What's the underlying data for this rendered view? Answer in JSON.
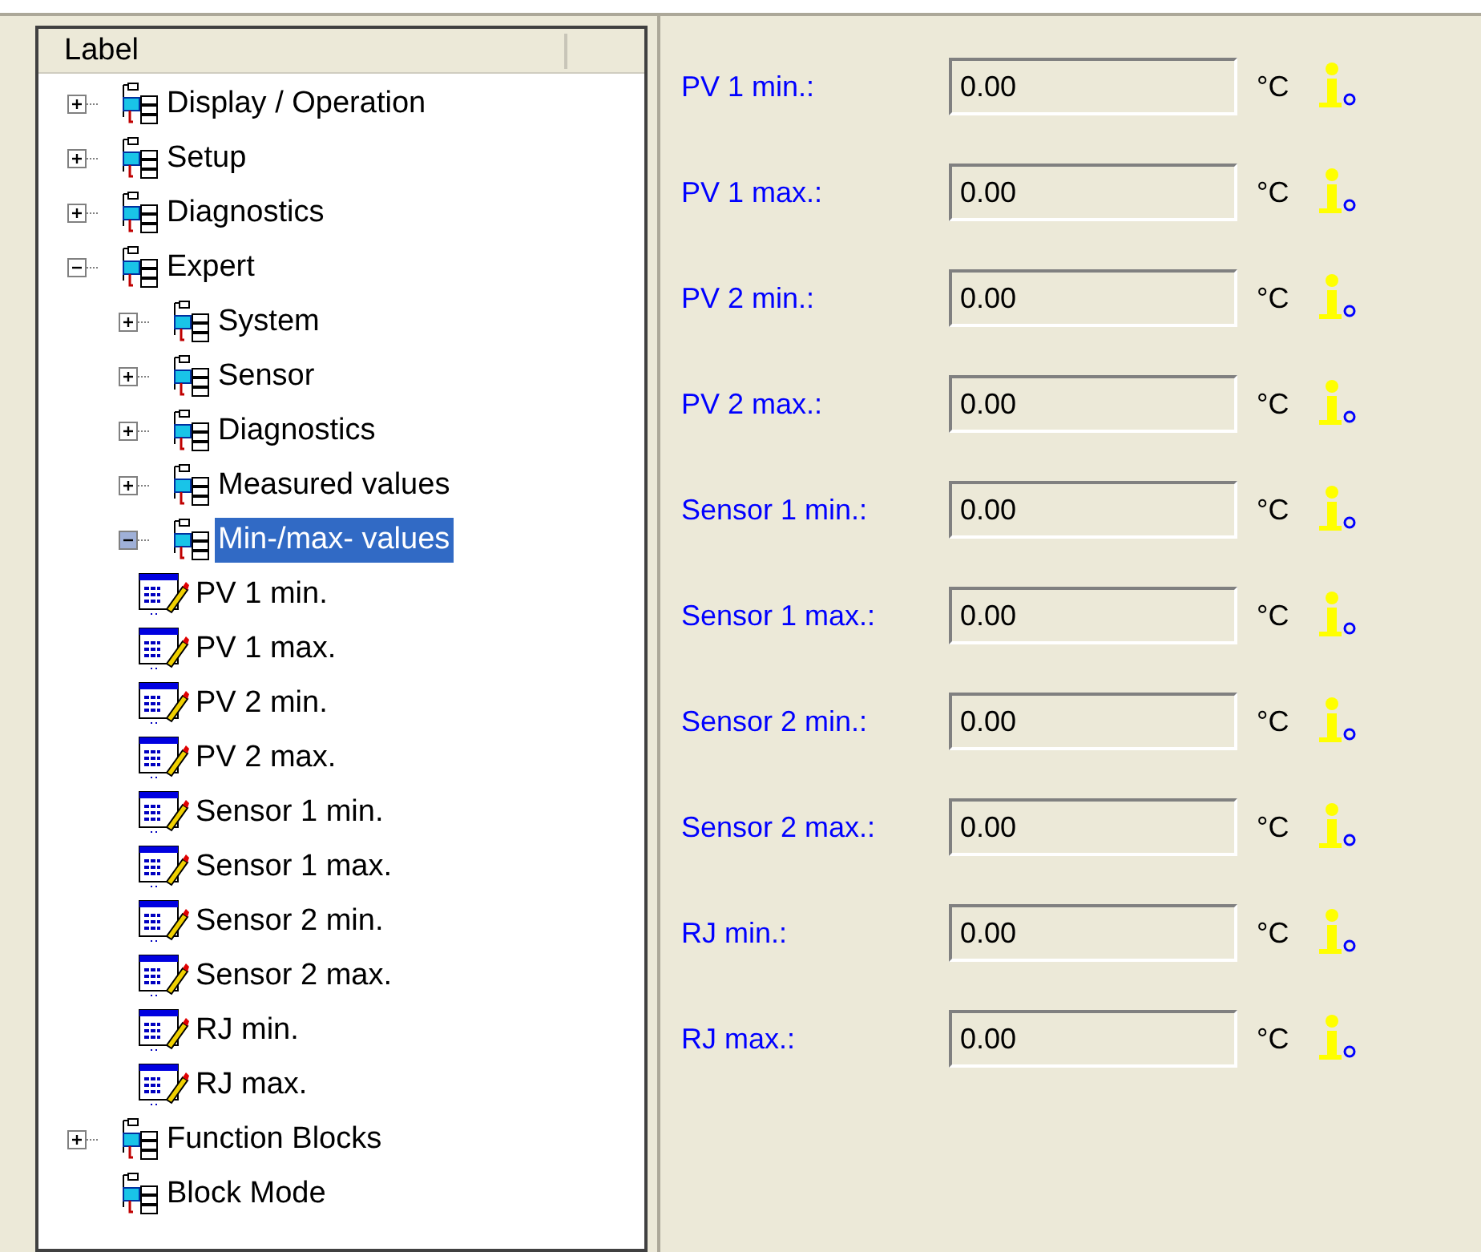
{
  "tree": {
    "header": "Label",
    "items": [
      {
        "label": "Display / Operation",
        "kind": "group",
        "expanded": false,
        "selected": false
      },
      {
        "label": "Setup",
        "kind": "group",
        "expanded": false,
        "selected": false
      },
      {
        "label": "Diagnostics",
        "kind": "group",
        "expanded": false,
        "selected": false
      },
      {
        "label": "Expert",
        "kind": "group",
        "expanded": true,
        "selected": false,
        "children": [
          {
            "label": "System",
            "kind": "group",
            "expanded": false,
            "selected": false
          },
          {
            "label": "Sensor",
            "kind": "group",
            "expanded": false,
            "selected": false
          },
          {
            "label": "Diagnostics",
            "kind": "group",
            "expanded": false,
            "selected": false
          },
          {
            "label": "Measured values",
            "kind": "group",
            "expanded": false,
            "selected": false
          },
          {
            "label": "Min-/max- values",
            "kind": "group",
            "expanded": true,
            "selected": true,
            "children": [
              {
                "label": "PV 1 min.",
                "kind": "parameter",
                "selected": false
              },
              {
                "label": "PV 1 max.",
                "kind": "parameter",
                "selected": false
              },
              {
                "label": "PV 2 min.",
                "kind": "parameter",
                "selected": false
              },
              {
                "label": "PV 2 max.",
                "kind": "parameter",
                "selected": false
              },
              {
                "label": "Sensor 1 min.",
                "kind": "parameter",
                "selected": false
              },
              {
                "label": "Sensor 1 max.",
                "kind": "parameter",
                "selected": false
              },
              {
                "label": "Sensor 2 min.",
                "kind": "parameter",
                "selected": false
              },
              {
                "label": "Sensor 2 max.",
                "kind": "parameter",
                "selected": false
              },
              {
                "label": "RJ min.",
                "kind": "parameter",
                "selected": false
              },
              {
                "label": "RJ max.",
                "kind": "parameter",
                "selected": false
              }
            ]
          }
        ]
      },
      {
        "label": "Function Blocks",
        "kind": "group",
        "expanded": false,
        "selected": false
      },
      {
        "label": "Block Mode",
        "kind": "folder",
        "selected": false
      }
    ]
  },
  "fields": [
    {
      "label": "PV 1 min.:",
      "value": "0.00",
      "unit": "°C"
    },
    {
      "label": "PV 1 max.:",
      "value": "0.00",
      "unit": "°C"
    },
    {
      "label": "PV 2 min.:",
      "value": "0.00",
      "unit": "°C"
    },
    {
      "label": "PV 2 max.:",
      "value": "0.00",
      "unit": "°C"
    },
    {
      "label": "Sensor 1 min.:",
      "value": "0.00",
      "unit": "°C"
    },
    {
      "label": "Sensor 1 max.:",
      "value": "0.00",
      "unit": "°C"
    },
    {
      "label": "Sensor 2 min.:",
      "value": "0.00",
      "unit": "°C"
    },
    {
      "label": "Sensor 2 max.:",
      "value": "0.00",
      "unit": "°C"
    },
    {
      "label": "RJ min.:",
      "value": "0.00",
      "unit": "°C"
    },
    {
      "label": "RJ max.:",
      "value": "0.00",
      "unit": "°C"
    }
  ]
}
